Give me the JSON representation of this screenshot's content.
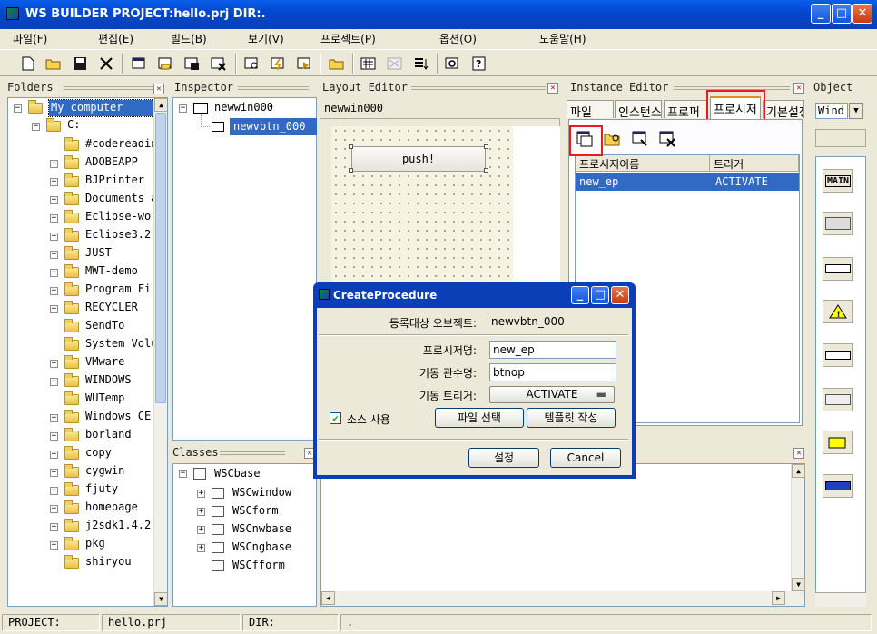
{
  "window": {
    "title": "WS BUILDER PROJECT:hello.prj DIR:."
  },
  "menu": [
    "파일(F)",
    "편집(E)",
    "빌드(B)",
    "보기(V)",
    "프로젝트(P)",
    "옵션(O)",
    "도움말(H)"
  ],
  "panels": {
    "folders": "Folders",
    "inspector": "Inspector",
    "layout": "Layout Editor",
    "instance": "Instance Editor",
    "object": "Object",
    "classes": "Classes"
  },
  "folders": {
    "root": "My computer",
    "drive": "C:",
    "items": [
      "#codereadin",
      "ADOBEAPP",
      "BJPrinter",
      "Documents a",
      "Eclipse-wor",
      "Eclipse3.2",
      "JUST",
      "MWT-demo",
      "Program Fi",
      "RECYCLER",
      "SendTo",
      "System Volu",
      "VMware",
      "WINDOWS",
      "WUTemp",
      "Windows CE",
      "borland",
      "copy",
      "cygwin",
      "fjuty",
      "homepage",
      "j2sdk1.4.2.",
      "pkg",
      "shiryou"
    ]
  },
  "inspector": {
    "root": "newwin000",
    "child": "newvbtn_000"
  },
  "layout_editor": {
    "window_name": "newwin000",
    "button_label": "push!"
  },
  "instance_editor": {
    "tabs": [
      "파일",
      "인스턴스",
      "프로퍼",
      "프로시저",
      "기본설정"
    ],
    "col_name": "프로시저이름",
    "col_trigger": "트리거",
    "row_name": "new_ep",
    "row_trigger": "ACTIVATE"
  },
  "object_panel": {
    "selector": "Wind",
    "items": [
      "MAIN"
    ]
  },
  "classes": {
    "root": "WSCbase",
    "items": [
      "WSCwindow",
      "WSCform",
      "WSCnwbase",
      "WSCngbase",
      "WSCfform"
    ]
  },
  "dialog": {
    "title": "CreateProcedure",
    "target_label": "등록대상 오브젝트:",
    "target_value": "newvbtn_000",
    "proc_label": "프로시저명:",
    "proc_value": "new_ep",
    "func_label": "기동 관수명:",
    "func_value": "btnop",
    "trigger_label": "기동 트리거:",
    "trigger_value": "ACTIVATE",
    "source_label": "소스 사용",
    "file_btn": "파일 선택",
    "template_btn": "템플릿 작성",
    "ok_btn": "설정",
    "cancel_btn": "Cancel"
  },
  "status": {
    "project_label": "PROJECT:",
    "project": "hello.prj",
    "dir_label": "DIR:",
    "dir": "."
  }
}
